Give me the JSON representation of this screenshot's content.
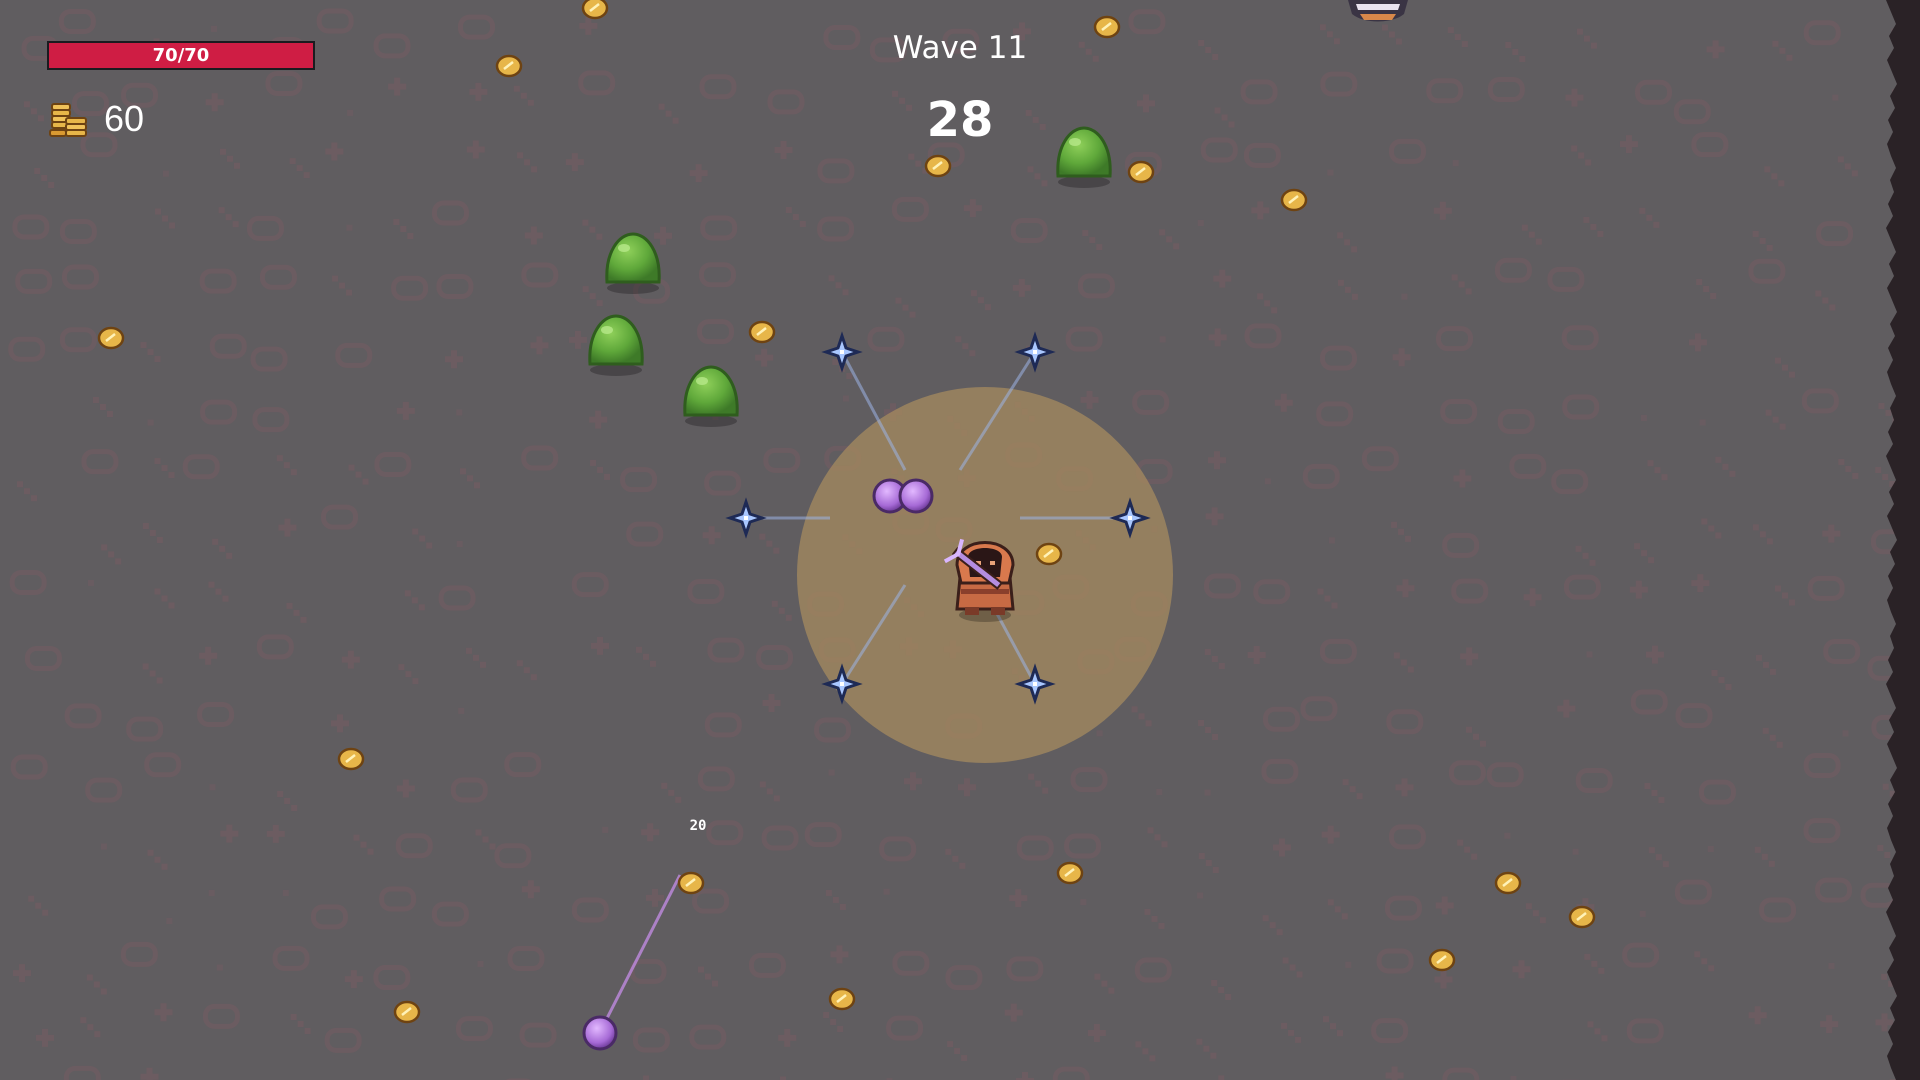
{
  "hud": {
    "hp_text": "70/70",
    "hp_current": 70,
    "hp_max": 70,
    "coins": "60",
    "wave_label": "Wave 11",
    "timer": "28",
    "damage_number": "20"
  },
  "icons": {
    "coins": "gold-coin-stack-icon",
    "pickup": "gold-coin-icon",
    "enemy": "green-slime",
    "projectile": "blue-shuriken",
    "orb": "purple-orb",
    "player": "hooded-player-character"
  },
  "colors": {
    "background": "#605d60",
    "floor_pattern": "#6e5c62",
    "hp_fill": "#cf1d44",
    "aura": "#a88c5e",
    "slime": "#5fa83a",
    "coin": "#e7b649",
    "shuriken": "#a9c7ff",
    "orb": "#b47be0",
    "wall": "#2a2226"
  }
}
